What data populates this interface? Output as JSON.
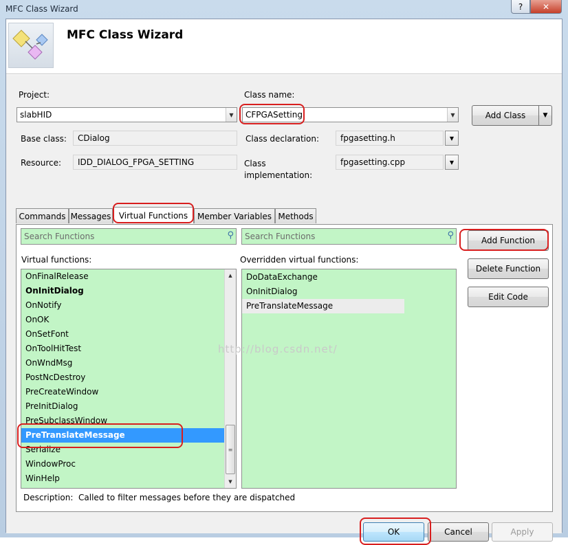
{
  "window": {
    "title": "MFC Class Wizard",
    "help_label": "?",
    "close_label": "✕"
  },
  "header": {
    "title": "MFC Class Wizard",
    "logo_icon": "wizard-shapes-icon"
  },
  "project": {
    "label": "Project:",
    "value": "slabHID"
  },
  "class_name": {
    "label": "Class name:",
    "value": "CFPGASetting"
  },
  "add_class": {
    "label": "Add Class",
    "arrow": "▼"
  },
  "base_class": {
    "label": "Base class:",
    "value": "CDialog"
  },
  "resource": {
    "label": "Resource:",
    "value": "IDD_DIALOG_FPGA_SETTING"
  },
  "class_declaration": {
    "label": "Class declaration:",
    "value": "fpgasetting.h"
  },
  "class_implementation": {
    "label": "Class implementation:",
    "value": "fpgasetting.cpp"
  },
  "tabs": [
    {
      "label": "Commands"
    },
    {
      "label": "Messages"
    },
    {
      "label": "Virtual Functions"
    },
    {
      "label": "Member Variables"
    },
    {
      "label": "Methods"
    }
  ],
  "active_tab": "Virtual Functions",
  "search_left": {
    "placeholder": "Search Functions"
  },
  "search_right": {
    "placeholder": "Search Functions"
  },
  "virtual_functions": {
    "label": "Virtual functions:",
    "items": [
      {
        "label": "OnFinalRelease"
      },
      {
        "label": "OnInitDialog",
        "bold": true
      },
      {
        "label": "OnNotify"
      },
      {
        "label": "OnOK"
      },
      {
        "label": "OnSetFont"
      },
      {
        "label": "OnToolHitTest"
      },
      {
        "label": "OnWndMsg"
      },
      {
        "label": "PostNcDestroy"
      },
      {
        "label": "PreCreateWindow"
      },
      {
        "label": "PreInitDialog"
      },
      {
        "label": "PreSubclassWindow"
      },
      {
        "label": "PreTranslateMessage",
        "selected": true
      },
      {
        "label": "Serialize"
      },
      {
        "label": "WindowProc"
      },
      {
        "label": "WinHelp"
      }
    ]
  },
  "overridden_functions": {
    "label": "Overridden virtual functions:",
    "items": [
      {
        "label": "DoDataExchange"
      },
      {
        "label": "OnInitDialog"
      },
      {
        "label": "PreTranslateMessage",
        "highlight": true
      }
    ]
  },
  "buttons": {
    "add_function": "Add Function",
    "delete_function": "Delete Function",
    "edit_code": "Edit Code",
    "ok": "OK",
    "cancel": "Cancel",
    "apply": "Apply"
  },
  "description": {
    "label": "Description:",
    "text": "Called to filter messages before they are dispatched"
  },
  "watermark": "http://blog.csdn.net/",
  "colors": {
    "list_background": "#c2f5c6",
    "selection": "#3399ff",
    "annotation_red": "#d81e1e"
  }
}
